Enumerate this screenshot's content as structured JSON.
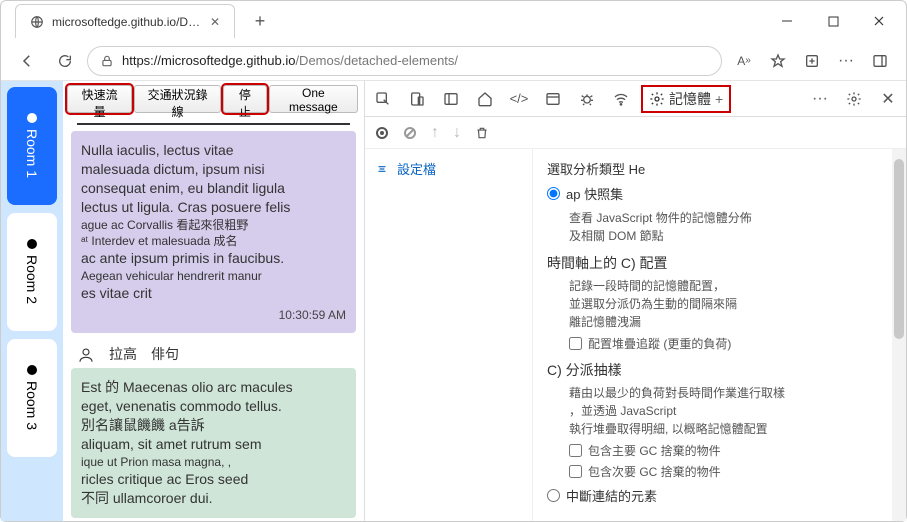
{
  "browser": {
    "tab_title": "microsoftedge.github.io/Demos/d",
    "url_prefix": "https://microsoftedge.github.io",
    "url_path": "/Demos/detached-elements/"
  },
  "rooms": [
    {
      "label": "Room 1",
      "active": true
    },
    {
      "label": "Room 2",
      "active": false
    },
    {
      "label": "Room 3",
      "active": false
    }
  ],
  "msg_toolbar": {
    "btn1": "快速流量",
    "btn2": "交通狀況錄線",
    "btn3": "停止",
    "btn4": "One message"
  },
  "message1": {
    "l1": "Nulla iaculis, lectus vitae",
    "l2": "malesuada dictum, ipsum nisi",
    "l3": "consequat enim, eu blandit ligula",
    "l4": "lectus ut ligula. Cras posuere felis",
    "l5": "ague ac Corvallis 看起來很粗野",
    "l6": "ᵃᵗ Interdev et malesuada 成名",
    "l7": "ac ante ipsum primis in faucibus.",
    "l8": "Aegean vehicular hendrerit manur",
    "l9": "es vitae crit",
    "time": "10:30:59 AM"
  },
  "post_header": {
    "name": "拉高",
    "sub": "俳句"
  },
  "message2": {
    "l1": "Est 的 Maecenas olio arc macules",
    "l2": "eget, venenatis commodo tellus.",
    "l3": "別名讓鼠饑饑 a告訴",
    "l4": "aliquam, sit amet rutrum sem",
    "l5": "ique ut    Prion masa magna, ,",
    "l6": "ricles critique ac Eros seed",
    "l7": "不同 ullamcoroer dui."
  },
  "devtools": {
    "memory_tab": "記憶體",
    "profiles_label": "設定檔",
    "select_type": "選取分析類型",
    "select_he": "He",
    "opt1": {
      "title": "ap 快照集",
      "desc1": "查看 JavaScript 物件的記憶體分佈",
      "desc2": "及相關 DOM 節點"
    },
    "section2_title": "時間軸上的 C) 配置",
    "section2_d1": "記錄一段時間的記憶體配置，",
    "section2_d2": "並選取分派仍為生動的間隔來隔",
    "section2_d3": "離記憶體洩漏",
    "cb1": "配置堆疊追蹤  (更重的負荷)",
    "section3_title": "C) 分派抽樣",
    "section3_d1": "藉由以最少的負荷對長時間作業進行取樣",
    "section3_d2": "，並透過 JavaScript",
    "section3_d3": "執行堆疊取得明細, 以概略記憶體配置",
    "cb2": "包含主要 GC 捨棄的物件",
    "cb3": "包含次要 GC 捨棄的物件",
    "opt4": "中斷連結的元素"
  }
}
